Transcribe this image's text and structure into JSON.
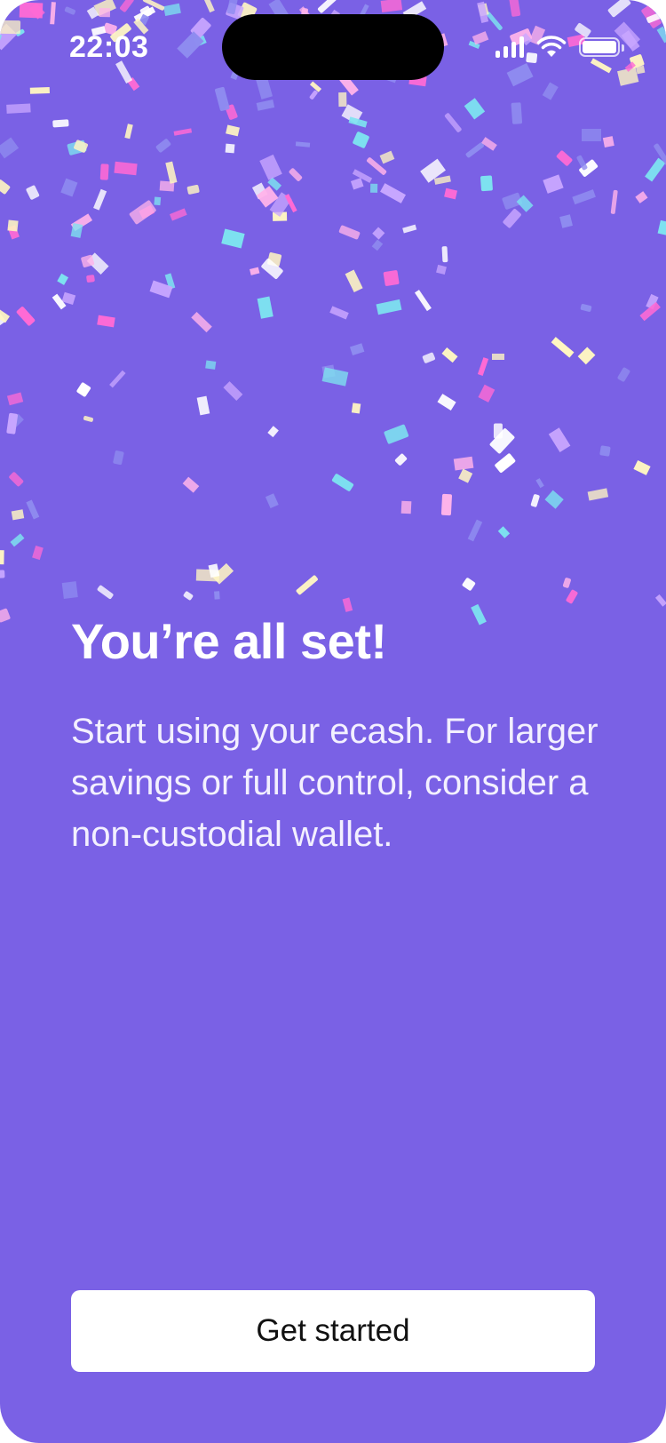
{
  "status_bar": {
    "time": "22:03",
    "icons": [
      "cellular-signal-icon",
      "wifi-icon",
      "battery-icon"
    ]
  },
  "onboarding": {
    "title": "You’re all set!",
    "description": "Start using your ecash. For larger savings or full control, consider a non-custodial wallet.",
    "button_label": "Get started"
  },
  "colors": {
    "background": "#7a61e5",
    "button_background": "#ffffff",
    "button_text": "#111111",
    "text": "#ffffff",
    "confetti": [
      "#ffffff",
      "#ff6ad5",
      "#ffb3ea",
      "#7de3f0",
      "#fff6c2",
      "#c9a7ff",
      "#8f8cf0"
    ]
  },
  "decoration": "confetti"
}
